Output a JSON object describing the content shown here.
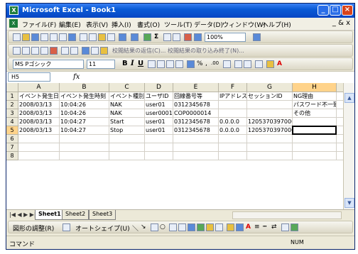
{
  "window": {
    "title": "Microsoft Excel - Book1",
    "app_icon_label": "X"
  },
  "menu": {
    "items": [
      "ファイル(F)",
      "編集(E)",
      "表示(V)",
      "挿入(I)",
      "書式(O)",
      "ツール(T)",
      "データ(D)",
      "ウィンドウ(W)",
      "ヘルプ(H)"
    ],
    "doc_controls": "_ & x"
  },
  "standard_toolbar": {
    "zoom": "100%"
  },
  "review_toolbar": {
    "text": "校閲結果の返信(C)...  校閲結果の取り込み終了(N)..."
  },
  "format_toolbar": {
    "font": "MS Pゴシック",
    "size": "11",
    "currency": "%",
    "comma": ",",
    "dec": ".00"
  },
  "formula_bar": {
    "name_box": "H5",
    "fx": "fx",
    "value": ""
  },
  "columns": [
    "A",
    "B",
    "C",
    "D",
    "E",
    "F",
    "G",
    "H",
    "I"
  ],
  "selected_column": "H",
  "rows": [
    {
      "num": "1",
      "cells": [
        "イベント発生日",
        "イベント発生時刻",
        "イベント種別",
        "ユーザID",
        "回線番号等",
        "IPアドレス",
        "セッションID",
        "NG理由",
        ""
      ]
    },
    {
      "num": "2",
      "cells": [
        "2008/03/13",
        "10:04:26",
        "NAK",
        "user01",
        "0312345678",
        "",
        "",
        "パスワード不一致",
        ""
      ]
    },
    {
      "num": "3",
      "cells": [
        "2008/03/13",
        "10:04:26",
        "NAK",
        "user00014",
        "COP0000014",
        "",
        "",
        "その他",
        ""
      ]
    },
    {
      "num": "4",
      "cells": [
        "2008/03/13",
        "10:04:27",
        "Start",
        "user01",
        "0312345678",
        "0.0.0.0",
        "120537039700001",
        "",
        ""
      ]
    },
    {
      "num": "5",
      "cells": [
        "2008/03/13",
        "10:04:27",
        "Stop",
        "user01",
        "0312345678",
        "0.0.0.0",
        "120537039700001",
        "",
        ""
      ]
    },
    {
      "num": "6",
      "cells": [
        "",
        "",
        "",
        "",
        "",
        "",
        "",
        "",
        ""
      ]
    },
    {
      "num": "7",
      "cells": [
        "",
        "",
        "",
        "",
        "",
        "",
        "",
        "",
        ""
      ]
    },
    {
      "num": "8",
      "cells": [
        "",
        "",
        "",
        "",
        "",
        "",
        "",
        "",
        ""
      ]
    }
  ],
  "sheets": {
    "nav": "|◀ ◀ ▶ ▶|",
    "tabs": [
      "Sheet1",
      "Sheet2",
      "Sheet3"
    ],
    "active": "Sheet1"
  },
  "drawing_toolbar": {
    "draw": "図形の調整(R)",
    "autoshape": "オートシェイプ(U)"
  },
  "status": {
    "text": "コマンド",
    "num": "NUM"
  }
}
